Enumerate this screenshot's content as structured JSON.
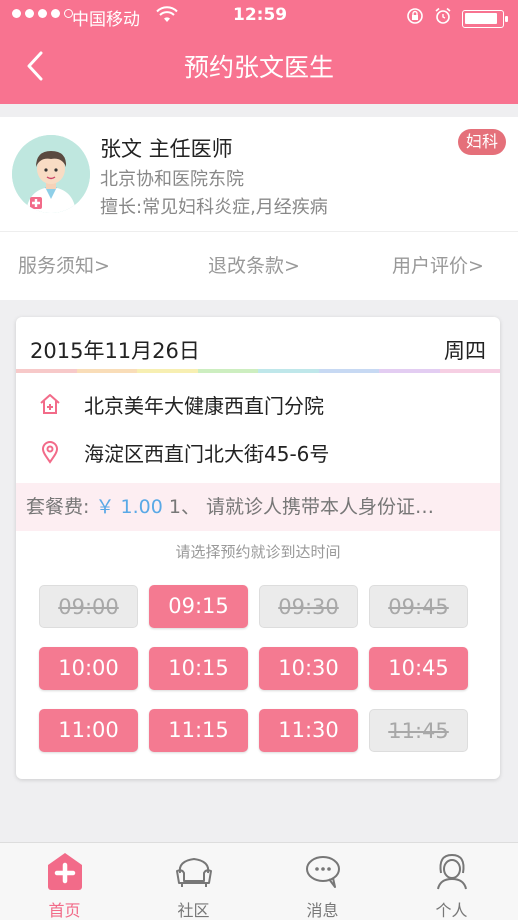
{
  "status_bar": {
    "carrier": "中国移动",
    "time": "12:59"
  },
  "header": {
    "title": "预约张文医生"
  },
  "doctor": {
    "name_title": "张文 主任医师",
    "hospital": "北京协和医院东院",
    "specialty": "擅长:常见妇科炎症,月经疾病",
    "department_tag": "妇科"
  },
  "links": [
    {
      "label": "服务须知>"
    },
    {
      "label": "退改条款>"
    },
    {
      "label": "用户评价>"
    }
  ],
  "appointment": {
    "date": "2015年11月26日",
    "weekday": "周四",
    "clinic": "北京美年大健康西直门分院",
    "address": "海淀区西直门北大街45-6号",
    "fee_label": "套餐费:",
    "fee_amount": "￥ 1.00",
    "fee_note": " 1、 请就诊人携带本人身份证…",
    "prompt": "请选择预约就诊到达时间",
    "slots": [
      {
        "time": "09:00",
        "available": false
      },
      {
        "time": "09:15",
        "available": true
      },
      {
        "time": "09:30",
        "available": false
      },
      {
        "time": "09:45",
        "available": false
      },
      {
        "time": "10:00",
        "available": true
      },
      {
        "time": "10:15",
        "available": true
      },
      {
        "time": "10:30",
        "available": true
      },
      {
        "time": "10:45",
        "available": true
      },
      {
        "time": "11:00",
        "available": true
      },
      {
        "time": "11:15",
        "available": true
      },
      {
        "time": "11:30",
        "available": true
      },
      {
        "time": "11:45",
        "available": false
      }
    ]
  },
  "tabs": [
    {
      "label": "首页",
      "icon": "home-icon",
      "active": true
    },
    {
      "label": "社区",
      "icon": "sofa-icon",
      "active": false
    },
    {
      "label": "消息",
      "icon": "chat-bubble-icon",
      "active": false
    },
    {
      "label": "个人",
      "icon": "person-icon",
      "active": false
    }
  ],
  "colors": {
    "brand": "#f87390",
    "slot_active": "#f47a91",
    "tag": "#e5707a",
    "price": "#5aa9e6"
  }
}
